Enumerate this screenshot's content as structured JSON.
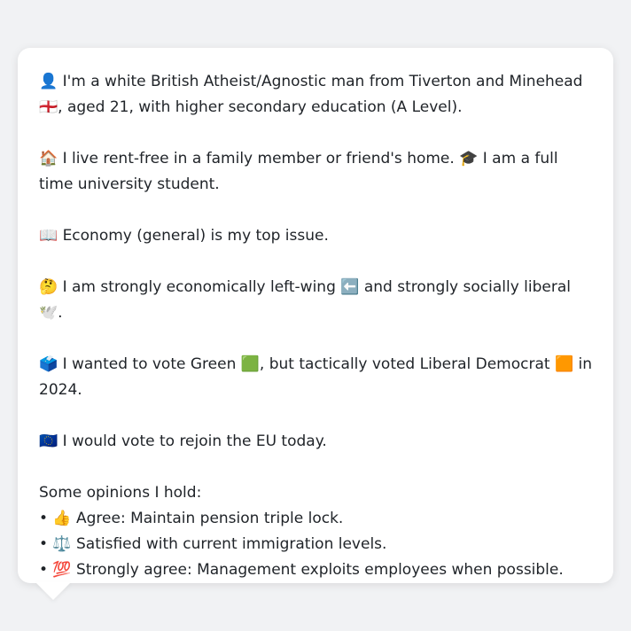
{
  "bio": {
    "identity_line": "👤 I'm a white British Atheist/Agnostic man from Tiverton and Minehead 🏴󠁧󠁢󠁥󠁮󠁧󠁿, aged 21, with higher secondary education (A Level).",
    "home_line": "🏠 I live rent-free in a family member or friend's home. 🎓 I am a full time university student.",
    "issue_line": "📖 Economy (general) is my top issue.",
    "ideology_line": "🤔 I am strongly economically left-wing ⬅️ and strongly socially liberal 🕊️.",
    "vote_line": "🗳️ I wanted to vote Green 🟩, but tactically voted Liberal Democrat 🟧 in 2024.",
    "eu_line": "🇪🇺 I would vote to rejoin the EU today.",
    "opinions_heading": "Some opinions I hold:",
    "opinions": [
      "• 👍 Agree: Maintain pension triple lock.",
      "• ⚖️ Satisfied with current immigration levels.",
      "• 💯 Strongly agree: Management exploits employees when possible."
    ]
  }
}
